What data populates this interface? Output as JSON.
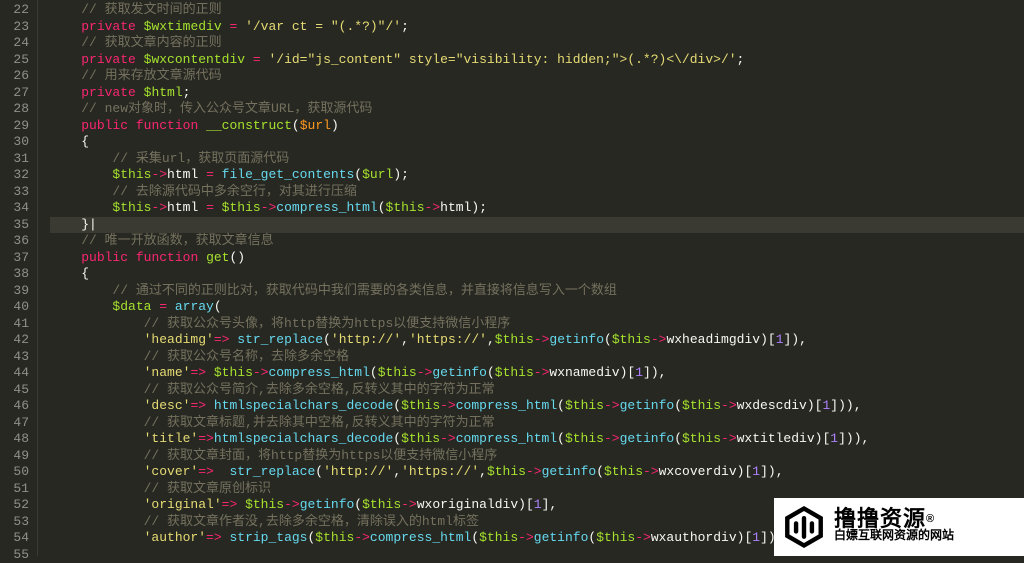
{
  "editor": {
    "firstLine": 22,
    "lastLine": 55,
    "highlightedLine": 35
  },
  "tokens": {
    "kw_private": "private",
    "kw_public": "public",
    "kw_function": "function",
    "kw_array": "array",
    "fn_construct": "__construct",
    "fn_get": "get",
    "call_file_get_contents": "file_get_contents",
    "call_compress_html": "compress_html",
    "call_getinfo": "getinfo",
    "call_str_replace": "str_replace",
    "call_htmlspecialchars_decode": "htmlspecialchars_decode",
    "call_strip_tags": "strip_tags",
    "var_wxtimediv": "$wxtimediv",
    "var_wxcontentdiv": "$wxcontentdiv",
    "var_html": "$html",
    "var_this": "$this",
    "var_url": "$url",
    "var_data": "$data",
    "prop_html": "html",
    "prop_wxheadimgdiv": "wxheadimgdiv",
    "prop_wxnamediv": "wxnamediv",
    "prop_wxdescdiv": "wxdescdiv",
    "prop_wxtitlediv": "wxtitlediv",
    "prop_wxcoverdiv": "wxcoverdiv",
    "prop_wxoriginaldiv": "wxoriginaldiv",
    "prop_wxauthordiv": "wxauthordiv",
    "key_headimg": "'headimg'",
    "key_name": "'name'",
    "key_desc": "'desc'",
    "key_title": "'title'",
    "key_cover": "'cover'",
    "key_original": "'original'",
    "key_author": "'author'",
    "str_wxtime": "'/var ct = \"(.*?)\"/'",
    "str_wxcontent": "'/id=\"js_content\" style=\"visibility: hidden;\">(.*?)<\\/div>/'",
    "str_http": "'http://'",
    "str_https": "'https://'",
    "num_1": "1",
    "arrow": "->",
    "arrow2": "=>",
    "eq": " = ",
    "cmt22": "// 获取发文时间的正则",
    "cmt24": "// 获取文章内容的正则",
    "cmt26": "// 用来存放文章源代码",
    "cmt28": "// new对象时，传入公众号文章URL，获取源代码",
    "cmt31": "// 采集url，获取页面源代码",
    "cmt33": "// 去除源代码中多余空行，对其进行压缩",
    "cmt36": "// 唯一开放函数，获取文章信息",
    "cmt39": "// 通过不同的正则比对，获取代码中我们需要的各类信息，并直接将信息写入一个数组",
    "cmt41": "// 获取公众号头像，将http替换为https以便支持微信小程序",
    "cmt43": "// 获取公众号名称，去除多余空格",
    "cmt45": "// 获取公众号简介,去除多余空格,反转义其中的字符为正常",
    "cmt47": "// 获取文章标题,并去除其中空格,反转义其中的字符为正常",
    "cmt49": "// 获取文章封面，将http替换为https以便支持微信小程序",
    "cmt51": "// 获取文章原创标识",
    "cmt53": "// 获取文章作者没,去除多余空格，清除误入的html标签",
    "brace_open": "{",
    "brace_close": "}",
    "brace_close_cursor": "}|",
    "paren_open": "(",
    "paren_close": ")",
    "bracket_open": "[",
    "bracket_close": "]",
    "semi": ";",
    "comma": ",",
    "comma_sp": ", "
  },
  "watermark": {
    "main": "撸撸资源",
    "sup": "®",
    "sub": "白嫖互联网资源的网站"
  }
}
